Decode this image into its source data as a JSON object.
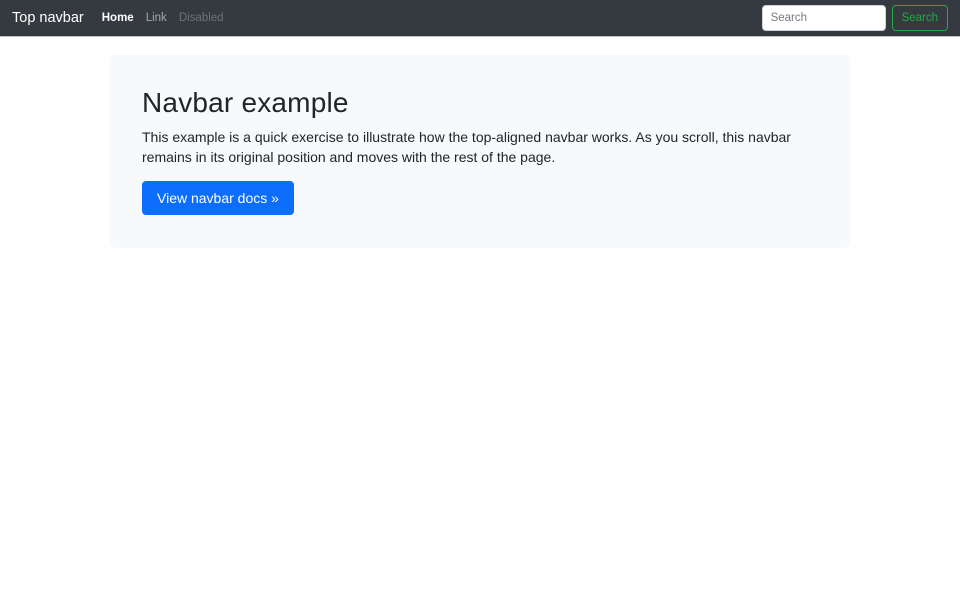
{
  "navbar": {
    "brand": "Top navbar",
    "links": [
      {
        "label": "Home",
        "state": "active"
      },
      {
        "label": "Link",
        "state": "default"
      },
      {
        "label": "Disabled",
        "state": "disabled"
      }
    ],
    "search": {
      "placeholder": "Search",
      "button_label": "Search"
    }
  },
  "jumbotron": {
    "title": "Navbar example",
    "description": "This example is a quick exercise to illustrate how the top-aligned navbar works. As you scroll, this navbar remains in its original position and moves with the rest of the page.",
    "cta_label": "View navbar docs »"
  },
  "colors": {
    "navbar_bg": "#343a40",
    "navbar_link_active": "#ffffff",
    "navbar_link_default": "rgba(255,255,255,0.55)",
    "navbar_link_disabled": "rgba(255,255,255,0.28)",
    "jumbotron_bg": "#f8f9fa",
    "primary_button_bg": "#0d6efd",
    "success_outline": "#28a745",
    "body_text": "#212529"
  }
}
